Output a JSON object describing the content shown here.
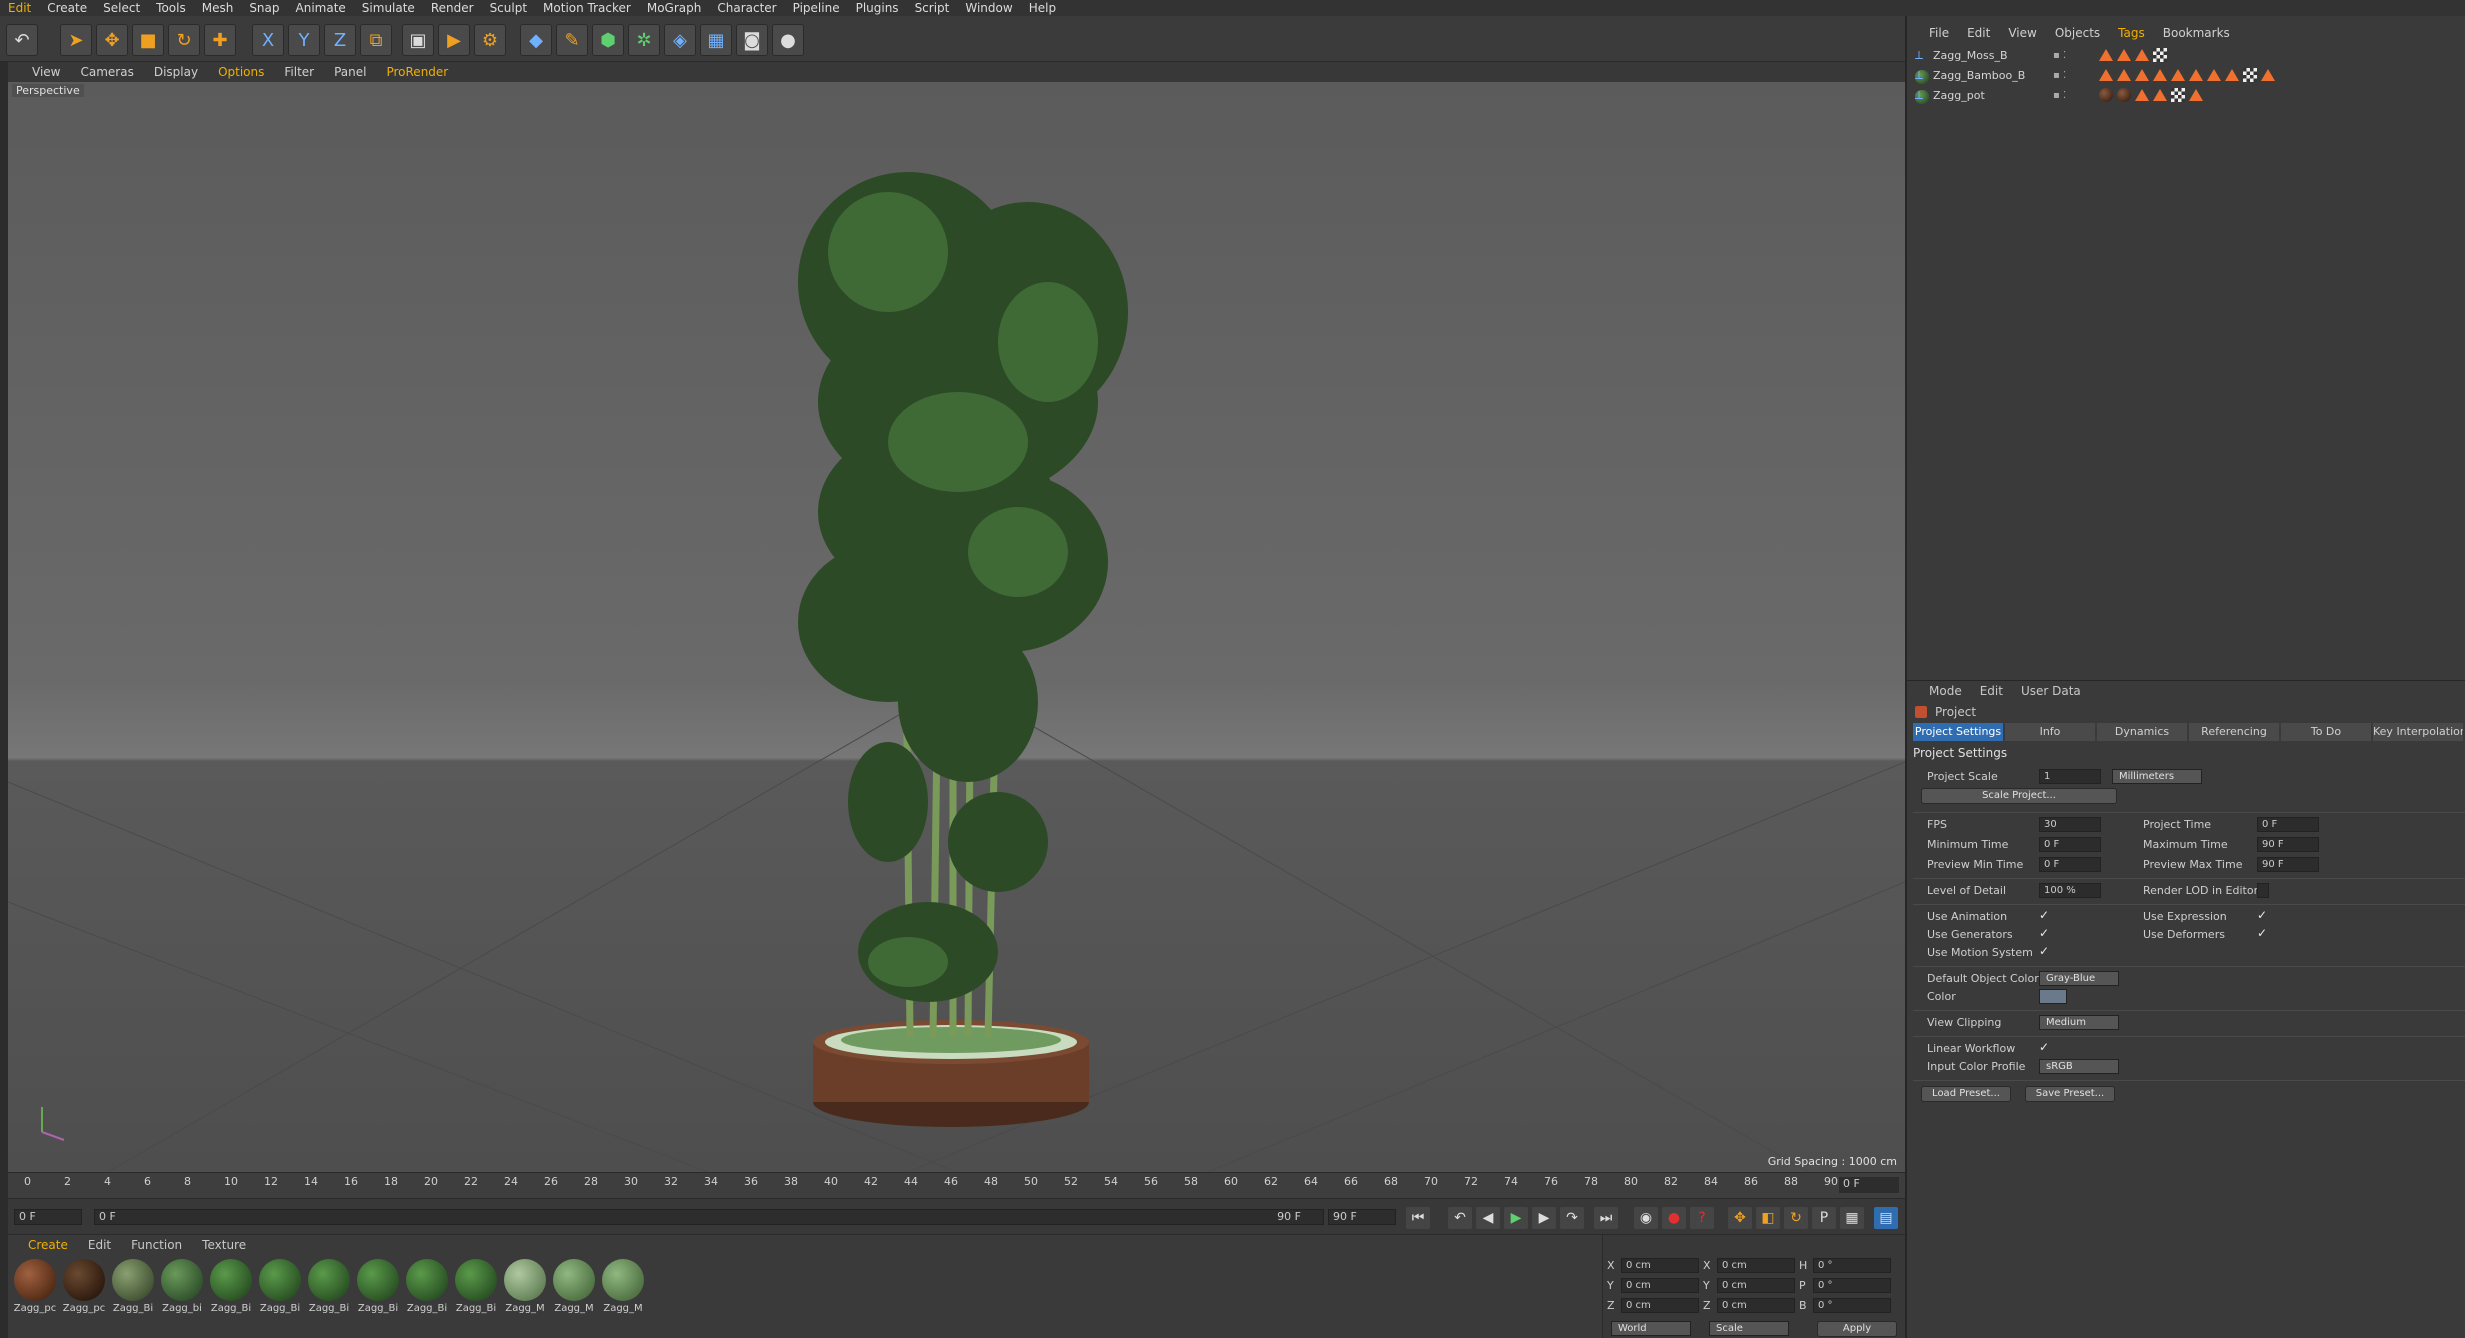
{
  "menu": [
    "Edit",
    "Create",
    "Select",
    "Tools",
    "Mesh",
    "Snap",
    "Animate",
    "Simulate",
    "Render",
    "Sculpt",
    "Motion Tracker",
    "MoGraph",
    "Character",
    "Pipeline",
    "Plugins",
    "Script",
    "Window",
    "Help"
  ],
  "toolbar_icons": [
    "undo-icon",
    "select-icon",
    "move-icon",
    "scale-icon",
    "rotate-icon",
    "add-icon",
    "x-axis-icon",
    "y-axis-icon",
    "z-axis-icon",
    "coord-system-icon",
    "render-view-icon",
    "render-picture-icon",
    "render-settings-icon",
    "cube-icon",
    "pen-icon",
    "subdivision-icon",
    "cloner-icon",
    "deformer-icon",
    "floor-icon",
    "camera-icon",
    "light-icon"
  ],
  "viewport": {
    "menu": [
      "View",
      "Cameras",
      "Display",
      "Options",
      "Filter",
      "Panel",
      "ProRender"
    ],
    "label": "Perspective",
    "grid_spacing": "Grid Spacing : 1000 cm"
  },
  "timeline": {
    "ticks": [
      "0",
      "2",
      "4",
      "6",
      "8",
      "10",
      "12",
      "14",
      "16",
      "18",
      "20",
      "22",
      "24",
      "26",
      "28",
      "30",
      "32",
      "34",
      "36",
      "38",
      "40",
      "42",
      "44",
      "46",
      "48",
      "50",
      "52",
      "54",
      "56",
      "58",
      "60",
      "62",
      "64",
      "66",
      "68",
      "70",
      "72",
      "74",
      "76",
      "78",
      "80",
      "82",
      "84",
      "86",
      "88",
      "90"
    ],
    "current": "0 F"
  },
  "transport": {
    "start": "0 F",
    "range_start": "0 F",
    "range_end": "90 F",
    "end": "90 F"
  },
  "materials": {
    "menu": [
      "Create",
      "Edit",
      "Function",
      "Texture"
    ],
    "items": [
      "Zagg_pc",
      "Zagg_pc",
      "Zagg_Bi",
      "Zagg_bi",
      "Zagg_Bi",
      "Zagg_Bi",
      "Zagg_Bi",
      "Zagg_Bi",
      "Zagg_Bi",
      "Zagg_Bi",
      "Zagg_M",
      "Zagg_M",
      "Zagg_M"
    ]
  },
  "coords": {
    "rows": [
      {
        "a": "X",
        "av": "0 cm",
        "b": "X",
        "bv": "0 cm",
        "c": "H",
        "cv": "0 °"
      },
      {
        "a": "Y",
        "av": "0 cm",
        "b": "Y",
        "bv": "0 cm",
        "c": "P",
        "cv": "0 °"
      },
      {
        "a": "Z",
        "av": "0 cm",
        "b": "Z",
        "bv": "0 cm",
        "c": "B",
        "cv": "0 °"
      }
    ],
    "world": "World",
    "scale": "Scale",
    "apply": "Apply"
  },
  "objects": {
    "menu": [
      "File",
      "Edit",
      "View",
      "Objects",
      "Tags",
      "Bookmarks"
    ],
    "items": [
      "Zagg_Moss_B",
      "Zagg_Bamboo_B",
      "Zagg_pot"
    ]
  },
  "attributes": {
    "menu": [
      "Mode",
      "Edit",
      "User Data"
    ],
    "head": "Project",
    "tabs": [
      "Project Settings",
      "Info",
      "Dynamics",
      "Referencing",
      "To Do",
      "Key Interpolation"
    ],
    "section": "Project Settings",
    "project_scale_label": "Project Scale",
    "project_scale": "1",
    "project_scale_unit": "Millimeters",
    "scale_project": "Scale Project...",
    "fps_label": "FPS",
    "fps": "30",
    "project_time_label": "Project Time",
    "project_time": "0 F",
    "min_time_label": "Minimum Time",
    "min_time": "0 F",
    "max_time_label": "Maximum Time",
    "max_time": "90 F",
    "prev_min_label": "Preview Min Time",
    "prev_min": "0 F",
    "prev_max_label": "Preview Max Time",
    "prev_max": "90 F",
    "lod_label": "Level of Detail",
    "lod": "100 %",
    "render_lod_label": "Render LOD in Editor",
    "use_animation": "Use Animation",
    "use_expression": "Use Expression",
    "use_generators": "Use Generators",
    "use_deformers": "Use Deformers",
    "use_motion": "Use Motion System",
    "default_color_label": "Default Object Color",
    "default_color": "Gray-Blue",
    "color_label": "Color",
    "view_clipping_label": "View Clipping",
    "view_clipping": "Medium",
    "linear_workflow": "Linear Workflow",
    "input_profile_label": "Input Color Profile",
    "input_profile": "sRGB",
    "load_preset": "Load Preset...",
    "save_preset": "Save Preset..."
  },
  "colors": {
    "accent": "#f0b000",
    "tab_active": "#2f6db0",
    "tag": "#f07030"
  }
}
